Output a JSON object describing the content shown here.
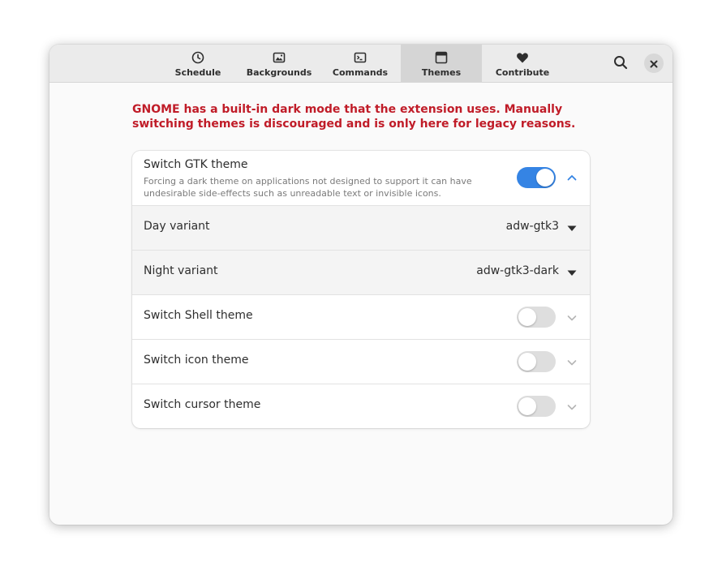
{
  "tabs": [
    {
      "label": "Schedule",
      "icon": "clock-icon",
      "active": false
    },
    {
      "label": "Backgrounds",
      "icon": "image-icon",
      "active": false
    },
    {
      "label": "Commands",
      "icon": "terminal-icon",
      "active": false
    },
    {
      "label": "Themes",
      "icon": "window-icon",
      "active": true
    },
    {
      "label": "Contribute",
      "icon": "heart-icon",
      "active": false
    }
  ],
  "header": {
    "search_icon": "search-icon",
    "close_icon": "close-icon"
  },
  "warning": "GNOME has a built-in dark mode that the extension uses. Manually switching themes is discouraged and is only here for legacy reasons.",
  "gtk": {
    "title": "Switch GTK theme",
    "subtitle": "Forcing a dark theme on applications not designed to support it can have undesirable side-effects such as unreadable text or invisible icons.",
    "enabled": true,
    "expanded": true,
    "day_label": "Day variant",
    "day_value": "adw-gtk3",
    "night_label": "Night variant",
    "night_value": "adw-gtk3-dark"
  },
  "shell": {
    "title": "Switch Shell theme",
    "enabled": false
  },
  "icon_theme": {
    "title": "Switch icon theme",
    "enabled": false
  },
  "cursor": {
    "title": "Switch cursor theme",
    "enabled": false
  },
  "colors": {
    "accent": "#3584e4",
    "warning": "#c01c28",
    "headerbar": "#ebebeb",
    "active_tab": "#d5d5d5"
  }
}
